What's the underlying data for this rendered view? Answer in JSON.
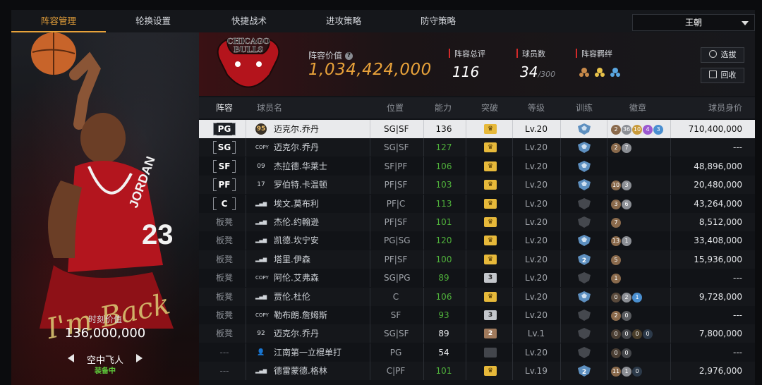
{
  "tabs": [
    "阵容管理",
    "轮换设置",
    "快捷战术",
    "进攻策略",
    "防守策略"
  ],
  "dynasty_select": "王朝",
  "team_logo_text": [
    "CHICAGO",
    "BULLS"
  ],
  "player_card": {
    "signature": "I'm Back",
    "value_label": "时刻价值",
    "value": "136,000,000",
    "skill": "空中飞人",
    "status": "装备中",
    "jersey_text": "JORDAN",
    "jersey_number": "23"
  },
  "header": {
    "lineup_value_label": "阵容价值",
    "lineup_value": "1,034,424,000",
    "stats": [
      {
        "label": "阵容总评",
        "value": "116",
        "suffix": ""
      },
      {
        "label": "球员数",
        "value": "34",
        "suffix": "/300"
      },
      {
        "label": "阵容羁绊",
        "value": "",
        "suffix": ""
      }
    ],
    "buttons": [
      "选拔",
      "回收"
    ]
  },
  "columns": [
    "阵容",
    "球员名",
    "位置",
    "能力",
    "突破",
    "等级",
    "训练",
    "徽章",
    "球员身价"
  ],
  "accent_color": "#e8a23a",
  "rows": [
    {
      "slot": "PG",
      "slot_type": "bracket",
      "num": "95",
      "name": "迈克尔.乔丹",
      "pos": "SG|SF",
      "ability": "136",
      "ability_color": "white",
      "break": "gold",
      "level": "Lv.20",
      "train": "blue",
      "badges": [
        [
          "2",
          "#8a6a4c"
        ],
        [
          "36",
          "#8c8f95"
        ],
        [
          "10",
          "#c89a3a"
        ],
        [
          "4",
          "#9b59d0"
        ],
        [
          "3",
          "#4a8fd0"
        ]
      ],
      "price": "710,400,000"
    },
    {
      "slot": "SG",
      "slot_type": "bracket",
      "num": "COPY",
      "name": "迈克尔.乔丹",
      "pos": "SG|SF",
      "ability": "127",
      "ability_color": "green",
      "break": "gold",
      "level": "Lv.20",
      "train": "blue",
      "badges": [
        [
          "2",
          "#8a6a4c"
        ],
        [
          "7",
          "#8c8f95"
        ]
      ],
      "price": "---"
    },
    {
      "slot": "SF",
      "slot_type": "bracket",
      "num": "09",
      "name": "杰拉德.华莱士",
      "pos": "SF|PF",
      "ability": "106",
      "ability_color": "green",
      "break": "gold",
      "level": "Lv.20",
      "train": "blue",
      "badges": [],
      "price": "48,896,000"
    },
    {
      "slot": "PF",
      "slot_type": "bracket",
      "num": "17",
      "name": "罗伯特.卡温顿",
      "pos": "PF|SF",
      "ability": "103",
      "ability_color": "green",
      "break": "gold",
      "level": "Lv.20",
      "train": "blue",
      "badges": [
        [
          "10",
          "#8a6a4c"
        ],
        [
          "3",
          "#8c8f95"
        ]
      ],
      "price": "20,480,000"
    },
    {
      "slot": "C",
      "slot_type": "bracket",
      "num": "bars",
      "name": "埃文.莫布利",
      "pos": "PF|C",
      "ability": "113",
      "ability_color": "green",
      "break": "gold",
      "level": "Lv.20",
      "train": "dim",
      "badges": [
        [
          "3",
          "#8a6a4c"
        ],
        [
          "6",
          "#8c8f95"
        ]
      ],
      "price": "43,264,000"
    },
    {
      "slot": "板凳",
      "slot_type": "bench",
      "num": "bars",
      "name": "杰伦.约翰逊",
      "pos": "PF|SF",
      "ability": "101",
      "ability_color": "green",
      "break": "gold",
      "level": "Lv.20",
      "train": "dim",
      "badges": [
        [
          "7",
          "#8a6a4c"
        ]
      ],
      "price": "8,512,000"
    },
    {
      "slot": "板凳",
      "slot_type": "bench",
      "num": "bars",
      "name": "凯德.坎宁安",
      "pos": "PG|SG",
      "ability": "120",
      "ability_color": "green",
      "break": "gold",
      "level": "Lv.20",
      "train": "blue",
      "badges": [
        [
          "13",
          "#8a6a4c"
        ],
        [
          "1",
          "#8c8f95"
        ]
      ],
      "price": "33,408,000"
    },
    {
      "slot": "板凳",
      "slot_type": "bench",
      "num": "bars",
      "name": "塔里.伊森",
      "pos": "PF|SF",
      "ability": "100",
      "ability_color": "green",
      "break": "gold",
      "level": "Lv.20",
      "train": "blue2",
      "badges": [
        [
          "5",
          "#8a6a4c"
        ]
      ],
      "price": "15,936,000"
    },
    {
      "slot": "板凳",
      "slot_type": "bench",
      "num": "COPY",
      "name": "阿伦.艾弗森",
      "pos": "SG|PG",
      "ability": "89",
      "ability_color": "green",
      "break": "grey3",
      "level": "Lv.20",
      "train": "dim",
      "badges": [
        [
          "1",
          "#8a6a4c"
        ]
      ],
      "price": "---"
    },
    {
      "slot": "板凳",
      "slot_type": "bench",
      "num": "bars",
      "name": "贾伦.杜伦",
      "pos": "C",
      "ability": "106",
      "ability_color": "green",
      "break": "gold",
      "level": "Lv.20",
      "train": "blue",
      "badges": [
        [
          "0",
          "#5a4a3c"
        ],
        [
          "2",
          "#8c8f95"
        ],
        [
          "1",
          "#4a8fd0"
        ]
      ],
      "price": "9,728,000"
    },
    {
      "slot": "板凳",
      "slot_type": "bench",
      "num": "COPY",
      "name": "勒布朗.詹姆斯",
      "pos": "SF",
      "ability": "93",
      "ability_color": "green",
      "break": "grey3",
      "level": "Lv.20",
      "train": "dim",
      "badges": [
        [
          "2",
          "#8a6a4c"
        ],
        [
          "0",
          "#5a5c60"
        ]
      ],
      "price": "---"
    },
    {
      "slot": "板凳",
      "slot_type": "bench",
      "num": "92",
      "name": "迈克尔.乔丹",
      "pos": "SG|SF",
      "ability": "89",
      "ability_color": "white",
      "break": "tan2",
      "level": "Lv.1",
      "train": "dim",
      "badges": [
        [
          "0",
          "#4a3e33"
        ],
        [
          "0",
          "#45474b"
        ],
        [
          "0",
          "#4a3e2a"
        ],
        [
          "0",
          "#2c3a4a"
        ]
      ],
      "price": "7,800,000"
    },
    {
      "slot": "---",
      "slot_type": "dash",
      "num": "person",
      "name": "江南第一立棍单打",
      "pos": "PG",
      "ability": "54",
      "ability_color": "white",
      "break": "dim",
      "level": "Lv.20",
      "train": "dim",
      "badges": [
        [
          "0",
          "#4a3e33"
        ],
        [
          "0",
          "#45474b"
        ]
      ],
      "price": "---"
    },
    {
      "slot": "---",
      "slot_type": "dash",
      "num": "bars",
      "name": "德雷蒙德.格林",
      "pos": "C|PF",
      "ability": "101",
      "ability_color": "green",
      "break": "gold",
      "level": "Lv.19",
      "train": "blue2",
      "badges": [
        [
          "11",
          "#8a6a4c"
        ],
        [
          "1",
          "#8c8f95"
        ],
        [
          "0",
          "#2c3a4a"
        ]
      ],
      "price": "2,976,000"
    }
  ]
}
